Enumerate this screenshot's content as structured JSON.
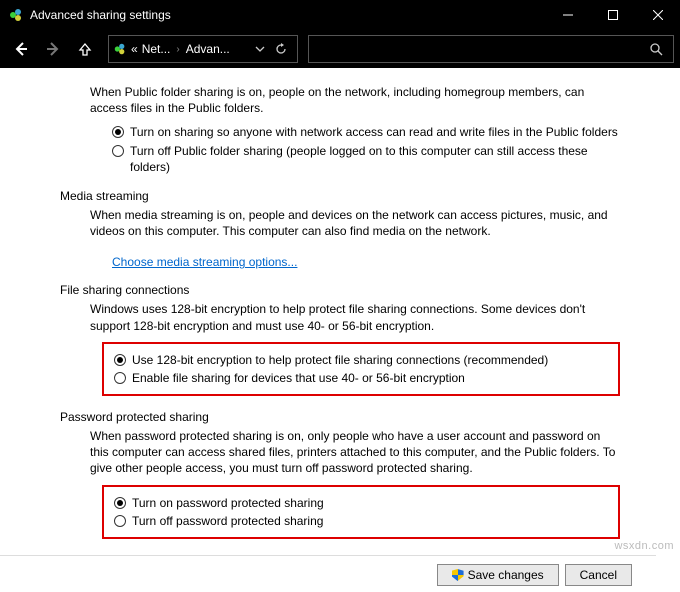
{
  "window": {
    "title": "Advanced sharing settings"
  },
  "breadcrumb": {
    "prefix": "«",
    "item1": "Net...",
    "item2": "Advan..."
  },
  "public_folder": {
    "desc": "When Public folder sharing is on, people on the network, including homegroup members, can access files in the Public folders.",
    "opt_on": "Turn on sharing so anyone with network access can read and write files in the Public folders",
    "opt_off": "Turn off Public folder sharing (people logged on to this computer can still access these folders)"
  },
  "media": {
    "title": "Media streaming",
    "desc": "When media streaming is on, people and devices on the network can access pictures, music, and videos on this computer. This computer can also find media on the network.",
    "link": "Choose media streaming options..."
  },
  "file_sharing": {
    "title": "File sharing connections",
    "desc": "Windows uses 128-bit encryption to help protect file sharing connections. Some devices don't support 128-bit encryption and must use 40- or 56-bit encryption.",
    "opt_128": "Use 128-bit encryption to help protect file sharing connections (recommended)",
    "opt_4056": "Enable file sharing for devices that use 40- or 56-bit encryption"
  },
  "password": {
    "title": "Password protected sharing",
    "desc": "When password protected sharing is on, only people who have a user account and password on this computer can access shared files, printers attached to this computer, and the Public folders. To give other people access, you must turn off password protected sharing.",
    "opt_on": "Turn on password protected sharing",
    "opt_off": "Turn off password protected sharing"
  },
  "footer": {
    "save": "Save changes",
    "cancel": "Cancel"
  },
  "watermark": "wsxdn.com"
}
